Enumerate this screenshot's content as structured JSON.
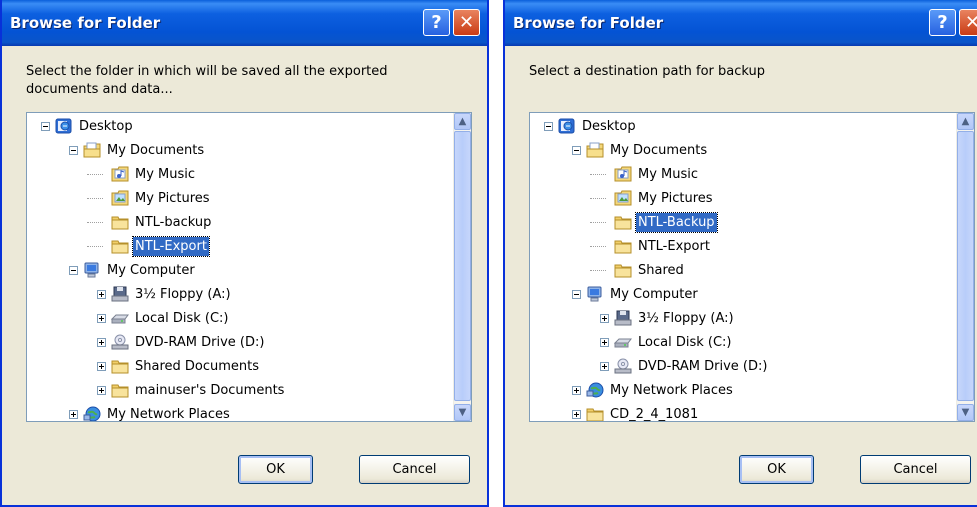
{
  "dialogs": [
    {
      "title": "Browse for Folder",
      "prompt_line1": "Select the folder in which will be saved all the exported",
      "prompt_line2": "documents and data...",
      "tree": [
        {
          "label": "Desktop",
          "icon": "desktop-icon",
          "expander": "minus"
        },
        {
          "label": "My Documents",
          "icon": "my-documents-icon",
          "expander": "minus"
        },
        {
          "label": "My Music",
          "icon": "music-folder-icon",
          "expander": ""
        },
        {
          "label": "My Pictures",
          "icon": "pictures-folder-icon",
          "expander": ""
        },
        {
          "label": "NTL-backup",
          "icon": "folder-icon",
          "expander": ""
        },
        {
          "label": "NTL-Export",
          "icon": "folder-icon",
          "expander": "",
          "selected": true
        },
        {
          "label": "My Computer",
          "icon": "computer-icon",
          "expander": "minus"
        },
        {
          "label": "3½ Floppy (A:)",
          "icon": "floppy-icon",
          "expander": "plus"
        },
        {
          "label": "Local Disk (C:)",
          "icon": "hard-disk-icon",
          "expander": "plus"
        },
        {
          "label": "DVD-RAM Drive (D:)",
          "icon": "dvd-icon",
          "expander": "plus"
        },
        {
          "label": "Shared Documents",
          "icon": "folder-icon",
          "expander": "plus"
        },
        {
          "label": "mainuser's Documents",
          "icon": "folder-icon",
          "expander": "plus"
        },
        {
          "label": "My Network Places",
          "icon": "network-icon",
          "expander": "plus"
        }
      ],
      "ok_label": "OK",
      "cancel_label": "Cancel",
      "help_glyph": "?",
      "close_glyph": "✕"
    },
    {
      "title": "Browse for Folder",
      "prompt_line1": "Select a destination path for backup",
      "prompt_line2": "",
      "tree": [
        {
          "label": "Desktop",
          "icon": "desktop-icon",
          "expander": "minus"
        },
        {
          "label": "My Documents",
          "icon": "my-documents-icon",
          "expander": "minus"
        },
        {
          "label": "My Music",
          "icon": "music-folder-icon",
          "expander": ""
        },
        {
          "label": "My Pictures",
          "icon": "pictures-folder-icon",
          "expander": ""
        },
        {
          "label": "NTL-Backup",
          "icon": "folder-icon",
          "expander": "",
          "selected": true
        },
        {
          "label": "NTL-Export",
          "icon": "folder-icon",
          "expander": ""
        },
        {
          "label": "Shared",
          "icon": "folder-icon",
          "expander": ""
        },
        {
          "label": "My Computer",
          "icon": "computer-icon",
          "expander": "minus"
        },
        {
          "label": "3½ Floppy (A:)",
          "icon": "floppy-icon",
          "expander": "plus"
        },
        {
          "label": "Local Disk (C:)",
          "icon": "hard-disk-icon",
          "expander": "plus"
        },
        {
          "label": "DVD-RAM Drive (D:)",
          "icon": "dvd-icon",
          "expander": "plus"
        },
        {
          "label": "My Network Places",
          "icon": "network-icon",
          "expander": "plus"
        },
        {
          "label": "CD_2_4_1081",
          "icon": "folder-icon",
          "expander": "plus"
        }
      ],
      "ok_label": "OK",
      "cancel_label": "Cancel",
      "help_glyph": "?",
      "close_glyph": "✕"
    }
  ],
  "colors": {
    "titlebar": "#0453d4",
    "selection": "#316ac5",
    "dialog_face": "#ece9d8",
    "tree_border": "#7f9db9"
  }
}
